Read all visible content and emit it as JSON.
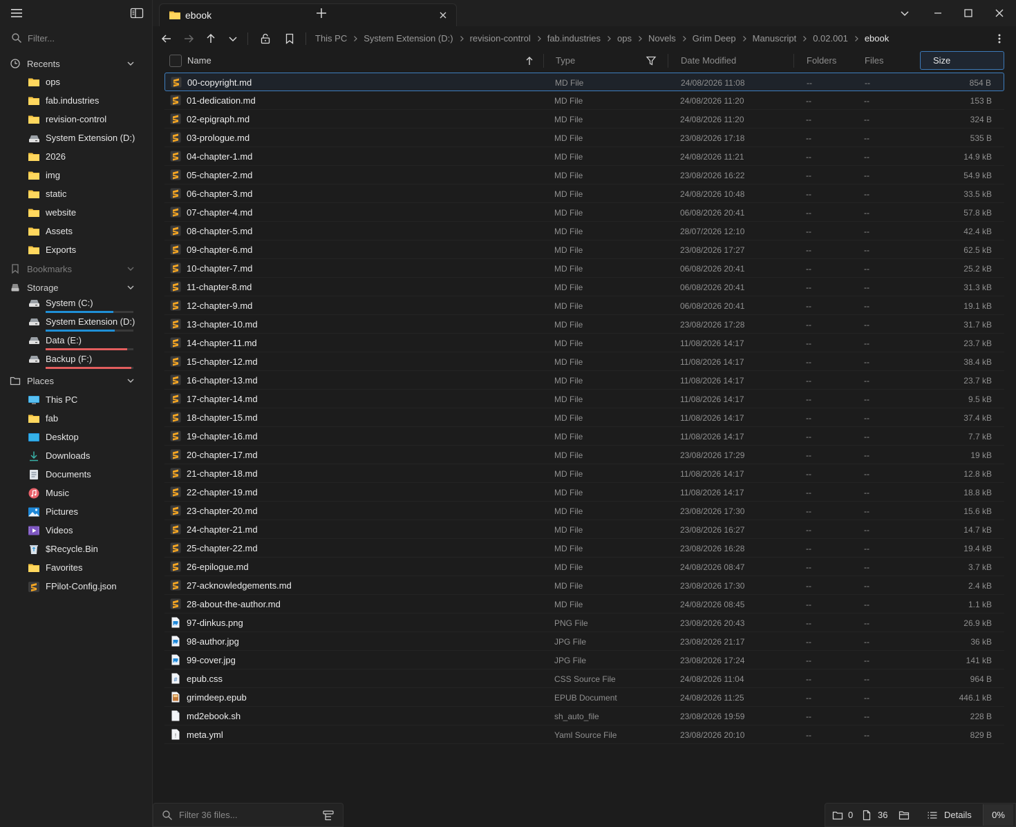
{
  "colors": {
    "folder": "#f5c342",
    "md_icon": "#f5a623",
    "drive_blue": "#1f8fd6",
    "drive_red": "#e35e5e",
    "accent": "#3d7ab8"
  },
  "sidebar": {
    "filter_placeholder": "Filter...",
    "sections": {
      "recents": "Recents",
      "bookmarks": "Bookmarks",
      "storage": "Storage",
      "places": "Places"
    },
    "recents": [
      {
        "label": "ops",
        "icon": "folder-icon"
      },
      {
        "label": "fab.industries",
        "icon": "folder-icon"
      },
      {
        "label": "revision-control",
        "icon": "folder-icon"
      },
      {
        "label": "System Extension (D:)",
        "icon": "drive-icon"
      },
      {
        "label": "2026",
        "icon": "folder-icon"
      },
      {
        "label": "img",
        "icon": "folder-icon"
      },
      {
        "label": "static",
        "icon": "folder-icon"
      },
      {
        "label": "website",
        "icon": "folder-icon"
      },
      {
        "label": "Assets",
        "icon": "folder-icon"
      },
      {
        "label": "Exports",
        "icon": "folder-icon"
      }
    ],
    "storage": [
      {
        "label": "System (C:)",
        "used_fraction": 0.77,
        "color": "#1f8fd6"
      },
      {
        "label": "System Extension (D:)",
        "used_fraction": 0.79,
        "color": "#1f8fd6"
      },
      {
        "label": "Data (E:)",
        "used_fraction": 0.93,
        "color": "#e35e5e"
      },
      {
        "label": "Backup (F:)",
        "used_fraction": 0.98,
        "color": "#e35e5e"
      }
    ],
    "places": [
      {
        "label": "This PC",
        "icon": "monitor-icon"
      },
      {
        "label": "fab",
        "icon": "folder-icon"
      },
      {
        "label": "Desktop",
        "icon": "desktop-icon"
      },
      {
        "label": "Downloads",
        "icon": "download-icon"
      },
      {
        "label": "Documents",
        "icon": "documents-icon"
      },
      {
        "label": "Music",
        "icon": "music-icon"
      },
      {
        "label": "Pictures",
        "icon": "pictures-icon"
      },
      {
        "label": "Videos",
        "icon": "videos-icon"
      },
      {
        "label": "$Recycle.Bin",
        "icon": "recycle-bin-icon"
      },
      {
        "label": "Favorites",
        "icon": "folder-icon"
      },
      {
        "label": "FPilot-Config.json",
        "icon": "sublime-file-icon"
      }
    ]
  },
  "tab": {
    "title": "ebook"
  },
  "breadcrumbs": [
    "This PC",
    "System Extension (D:)",
    "revision-control",
    "fab.industries",
    "ops",
    "Novels",
    "Grim Deep",
    "Manuscript",
    "0.02.001",
    "ebook"
  ],
  "columns": {
    "name": "Name",
    "type": "Type",
    "date": "Date Modified",
    "folders": "Folders",
    "files": "Files",
    "size": "Size"
  },
  "files": [
    {
      "name": "00-copyright.md",
      "type": "MD File",
      "date": "24/08/2026 11:08",
      "folders": "--",
      "files": "--",
      "size": "854 B",
      "icon": "md"
    },
    {
      "name": "01-dedication.md",
      "type": "MD File",
      "date": "24/08/2026 11:20",
      "folders": "--",
      "files": "--",
      "size": "153 B",
      "icon": "md"
    },
    {
      "name": "02-epigraph.md",
      "type": "MD File",
      "date": "24/08/2026 11:20",
      "folders": "--",
      "files": "--",
      "size": "324 B",
      "icon": "md"
    },
    {
      "name": "03-prologue.md",
      "type": "MD File",
      "date": "23/08/2026 17:18",
      "folders": "--",
      "files": "--",
      "size": "535 B",
      "icon": "md"
    },
    {
      "name": "04-chapter-1.md",
      "type": "MD File",
      "date": "24/08/2026 11:21",
      "folders": "--",
      "files": "--",
      "size": "14.9 kB",
      "icon": "md"
    },
    {
      "name": "05-chapter-2.md",
      "type": "MD File",
      "date": "23/08/2026 16:22",
      "folders": "--",
      "files": "--",
      "size": "54.9 kB",
      "icon": "md"
    },
    {
      "name": "06-chapter-3.md",
      "type": "MD File",
      "date": "24/08/2026 10:48",
      "folders": "--",
      "files": "--",
      "size": "33.5 kB",
      "icon": "md"
    },
    {
      "name": "07-chapter-4.md",
      "type": "MD File",
      "date": "06/08/2026 20:41",
      "folders": "--",
      "files": "--",
      "size": "57.8 kB",
      "icon": "md"
    },
    {
      "name": "08-chapter-5.md",
      "type": "MD File",
      "date": "28/07/2026 12:10",
      "folders": "--",
      "files": "--",
      "size": "42.4 kB",
      "icon": "md"
    },
    {
      "name": "09-chapter-6.md",
      "type": "MD File",
      "date": "23/08/2026 17:27",
      "folders": "--",
      "files": "--",
      "size": "62.5 kB",
      "icon": "md"
    },
    {
      "name": "10-chapter-7.md",
      "type": "MD File",
      "date": "06/08/2026 20:41",
      "folders": "--",
      "files": "--",
      "size": "25.2 kB",
      "icon": "md"
    },
    {
      "name": "11-chapter-8.md",
      "type": "MD File",
      "date": "06/08/2026 20:41",
      "folders": "--",
      "files": "--",
      "size": "31.3 kB",
      "icon": "md"
    },
    {
      "name": "12-chapter-9.md",
      "type": "MD File",
      "date": "06/08/2026 20:41",
      "folders": "--",
      "files": "--",
      "size": "19.1 kB",
      "icon": "md"
    },
    {
      "name": "13-chapter-10.md",
      "type": "MD File",
      "date": "23/08/2026 17:28",
      "folders": "--",
      "files": "--",
      "size": "31.7 kB",
      "icon": "md"
    },
    {
      "name": "14-chapter-11.md",
      "type": "MD File",
      "date": "11/08/2026 14:17",
      "folders": "--",
      "files": "--",
      "size": "23.7 kB",
      "icon": "md"
    },
    {
      "name": "15-chapter-12.md",
      "type": "MD File",
      "date": "11/08/2026 14:17",
      "folders": "--",
      "files": "--",
      "size": "38.4 kB",
      "icon": "md"
    },
    {
      "name": "16-chapter-13.md",
      "type": "MD File",
      "date": "11/08/2026 14:17",
      "folders": "--",
      "files": "--",
      "size": "23.7 kB",
      "icon": "md"
    },
    {
      "name": "17-chapter-14.md",
      "type": "MD File",
      "date": "11/08/2026 14:17",
      "folders": "--",
      "files": "--",
      "size": "9.5 kB",
      "icon": "md"
    },
    {
      "name": "18-chapter-15.md",
      "type": "MD File",
      "date": "11/08/2026 14:17",
      "folders": "--",
      "files": "--",
      "size": "37.4 kB",
      "icon": "md"
    },
    {
      "name": "19-chapter-16.md",
      "type": "MD File",
      "date": "11/08/2026 14:17",
      "folders": "--",
      "files": "--",
      "size": "7.7 kB",
      "icon": "md"
    },
    {
      "name": "20-chapter-17.md",
      "type": "MD File",
      "date": "23/08/2026 17:29",
      "folders": "--",
      "files": "--",
      "size": "19 kB",
      "icon": "md"
    },
    {
      "name": "21-chapter-18.md",
      "type": "MD File",
      "date": "11/08/2026 14:17",
      "folders": "--",
      "files": "--",
      "size": "12.8 kB",
      "icon": "md"
    },
    {
      "name": "22-chapter-19.md",
      "type": "MD File",
      "date": "11/08/2026 14:17",
      "folders": "--",
      "files": "--",
      "size": "18.8 kB",
      "icon": "md"
    },
    {
      "name": "23-chapter-20.md",
      "type": "MD File",
      "date": "23/08/2026 17:30",
      "folders": "--",
      "files": "--",
      "size": "15.6 kB",
      "icon": "md"
    },
    {
      "name": "24-chapter-21.md",
      "type": "MD File",
      "date": "23/08/2026 16:27",
      "folders": "--",
      "files": "--",
      "size": "14.7 kB",
      "icon": "md"
    },
    {
      "name": "25-chapter-22.md",
      "type": "MD File",
      "date": "23/08/2026 16:28",
      "folders": "--",
      "files": "--",
      "size": "19.4 kB",
      "icon": "md"
    },
    {
      "name": "26-epilogue.md",
      "type": "MD File",
      "date": "24/08/2026 08:47",
      "folders": "--",
      "files": "--",
      "size": "3.7 kB",
      "icon": "md"
    },
    {
      "name": "27-acknowledgements.md",
      "type": "MD File",
      "date": "23/08/2026 17:30",
      "folders": "--",
      "files": "--",
      "size": "2.4 kB",
      "icon": "md"
    },
    {
      "name": "28-about-the-author.md",
      "type": "MD File",
      "date": "24/08/2026 08:45",
      "folders": "--",
      "files": "--",
      "size": "1.1 kB",
      "icon": "md"
    },
    {
      "name": "97-dinkus.png",
      "type": "PNG File",
      "date": "23/08/2026 20:43",
      "folders": "--",
      "files": "--",
      "size": "26.9 kB",
      "icon": "image"
    },
    {
      "name": "98-author.jpg",
      "type": "JPG File",
      "date": "23/08/2026 21:17",
      "folders": "--",
      "files": "--",
      "size": "36 kB",
      "icon": "image"
    },
    {
      "name": "99-cover.jpg",
      "type": "JPG File",
      "date": "23/08/2026 17:24",
      "folders": "--",
      "files": "--",
      "size": "141 kB",
      "icon": "image"
    },
    {
      "name": "epub.css",
      "type": "CSS Source File",
      "date": "24/08/2026 11:04",
      "folders": "--",
      "files": "--",
      "size": "964 B",
      "icon": "css"
    },
    {
      "name": "grimdeep.epub",
      "type": "EPUB Document",
      "date": "24/08/2026 11:25",
      "folders": "--",
      "files": "--",
      "size": "446.1 kB",
      "icon": "epub"
    },
    {
      "name": "md2ebook.sh",
      "type": "sh_auto_file",
      "date": "23/08/2026 19:59",
      "folders": "--",
      "files": "--",
      "size": "228 B",
      "icon": "blank"
    },
    {
      "name": "meta.yml",
      "type": "Yaml Source File",
      "date": "23/08/2026 20:10",
      "folders": "--",
      "files": "--",
      "size": "829 B",
      "icon": "yaml"
    }
  ],
  "bottom": {
    "filter_placeholder": "Filter 36 files...",
    "folder_count": "0",
    "file_count": "36",
    "view_label": "Details",
    "percent": "0%"
  }
}
